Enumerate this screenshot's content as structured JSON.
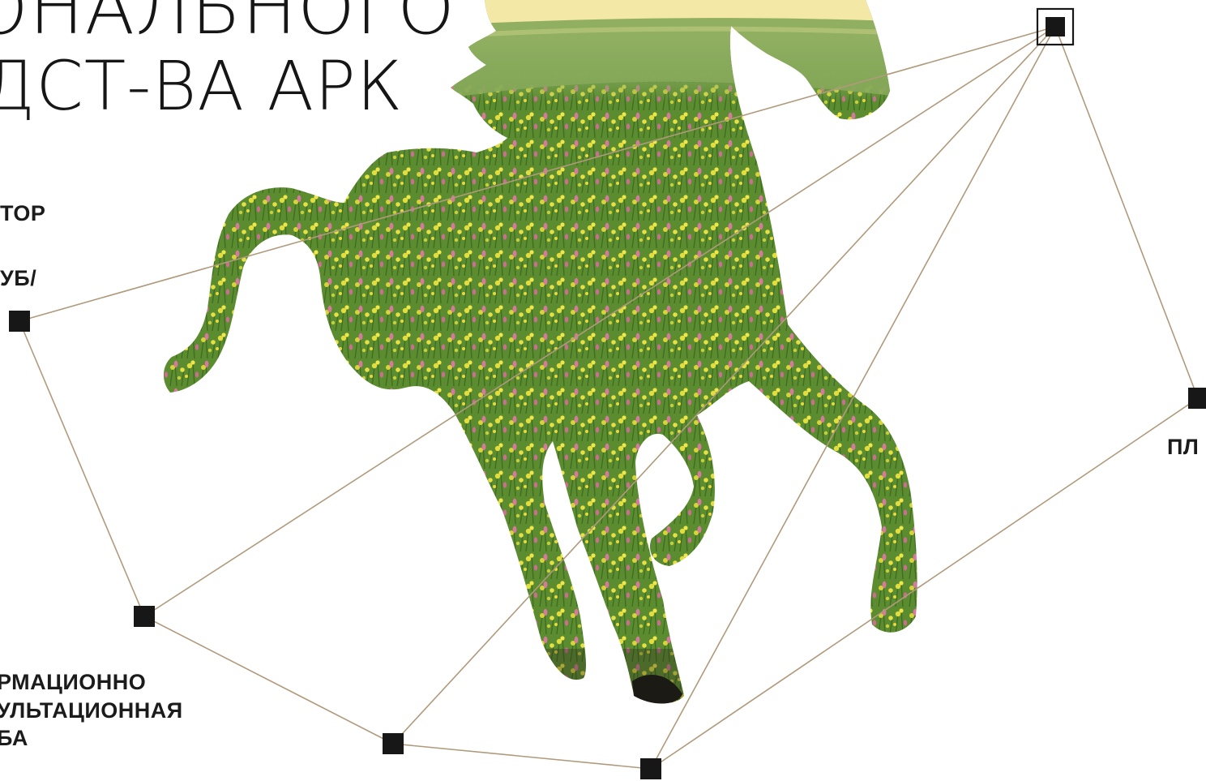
{
  "title": {
    "line1": "ОНАЛЬНОГО",
    "line2": "ДСТ-ВА АРК"
  },
  "labels": {
    "label_1": "ТОР",
    "label_2": "УБ/",
    "label_3": "РМАЦИОННО\nУЛЬТАЦИОННАЯ\nБА",
    "label_4": "ПЛ"
  },
  "colors": {
    "line": "#b09a7c",
    "node": "#171717",
    "sky_top": "#f4e7a4",
    "hill": "#7fa25a",
    "meadow": "#6d9a3a",
    "flower_yellow": "#e1dd3f",
    "flower_pink": "#d97aa0"
  },
  "illustration": "galloping-horse-silhouette-filled-with-meadow-photo"
}
